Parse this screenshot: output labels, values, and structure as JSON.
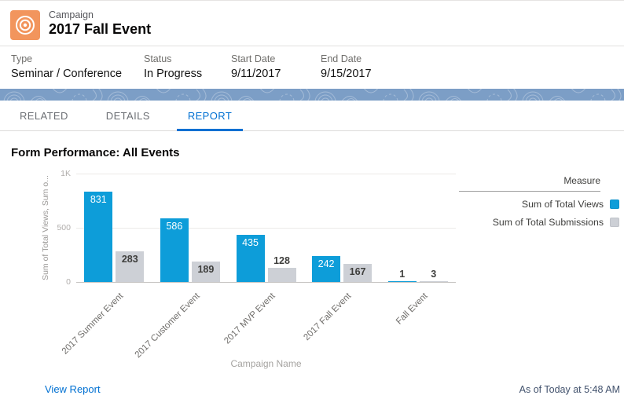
{
  "header": {
    "record_type": "Campaign",
    "title": "2017 Fall Event",
    "icon": "campaign-bullseye-icon",
    "icon_color": "#F2955D"
  },
  "fields": [
    {
      "label": "Type",
      "value": "Seminar / Conference"
    },
    {
      "label": "Status",
      "value": "In Progress"
    },
    {
      "label": "Start Date",
      "value": "9/11/2017"
    },
    {
      "label": "End Date",
      "value": "9/15/2017"
    }
  ],
  "tabs": [
    {
      "label": "RELATED",
      "active": false
    },
    {
      "label": "DETAILS",
      "active": false
    },
    {
      "label": "REPORT",
      "active": true
    }
  ],
  "report": {
    "title": "Form Performance: All Events",
    "view_report_label": "View Report",
    "as_of": "As of Today at 5:48 AM"
  },
  "chart_data": {
    "type": "bar",
    "title": "Form Performance: All Events",
    "categories": [
      "2017 Summer Event",
      "2017 Customer Event",
      "2017 MVP Event",
      "2017 Fall Event",
      "Fall Event"
    ],
    "series": [
      {
        "name": "Sum of Total Views",
        "color": "#0D9DD9",
        "values": [
          831,
          586,
          435,
          242,
          1
        ]
      },
      {
        "name": "Sum of Total Submissions",
        "color": "#CDD0D6",
        "values": [
          283,
          189,
          128,
          167,
          3
        ]
      }
    ],
    "xlabel": "Campaign Name",
    "ylabel": "Sum of Total Views, Sum o...",
    "ylim": [
      0,
      1000
    ],
    "yticks": [
      {
        "value": 0,
        "label": "0"
      },
      {
        "value": 500,
        "label": "500"
      },
      {
        "value": 1000,
        "label": "1K"
      }
    ],
    "legend_title": "Measure",
    "legend_position": "right",
    "grid": true,
    "value_labels": true
  },
  "colors": {
    "brand_blue": "#0070D2",
    "band_blue": "#7C9EC6",
    "bar_blue": "#0D9DD9",
    "bar_gray": "#CDD0D6",
    "icon_orange": "#F2955D"
  }
}
